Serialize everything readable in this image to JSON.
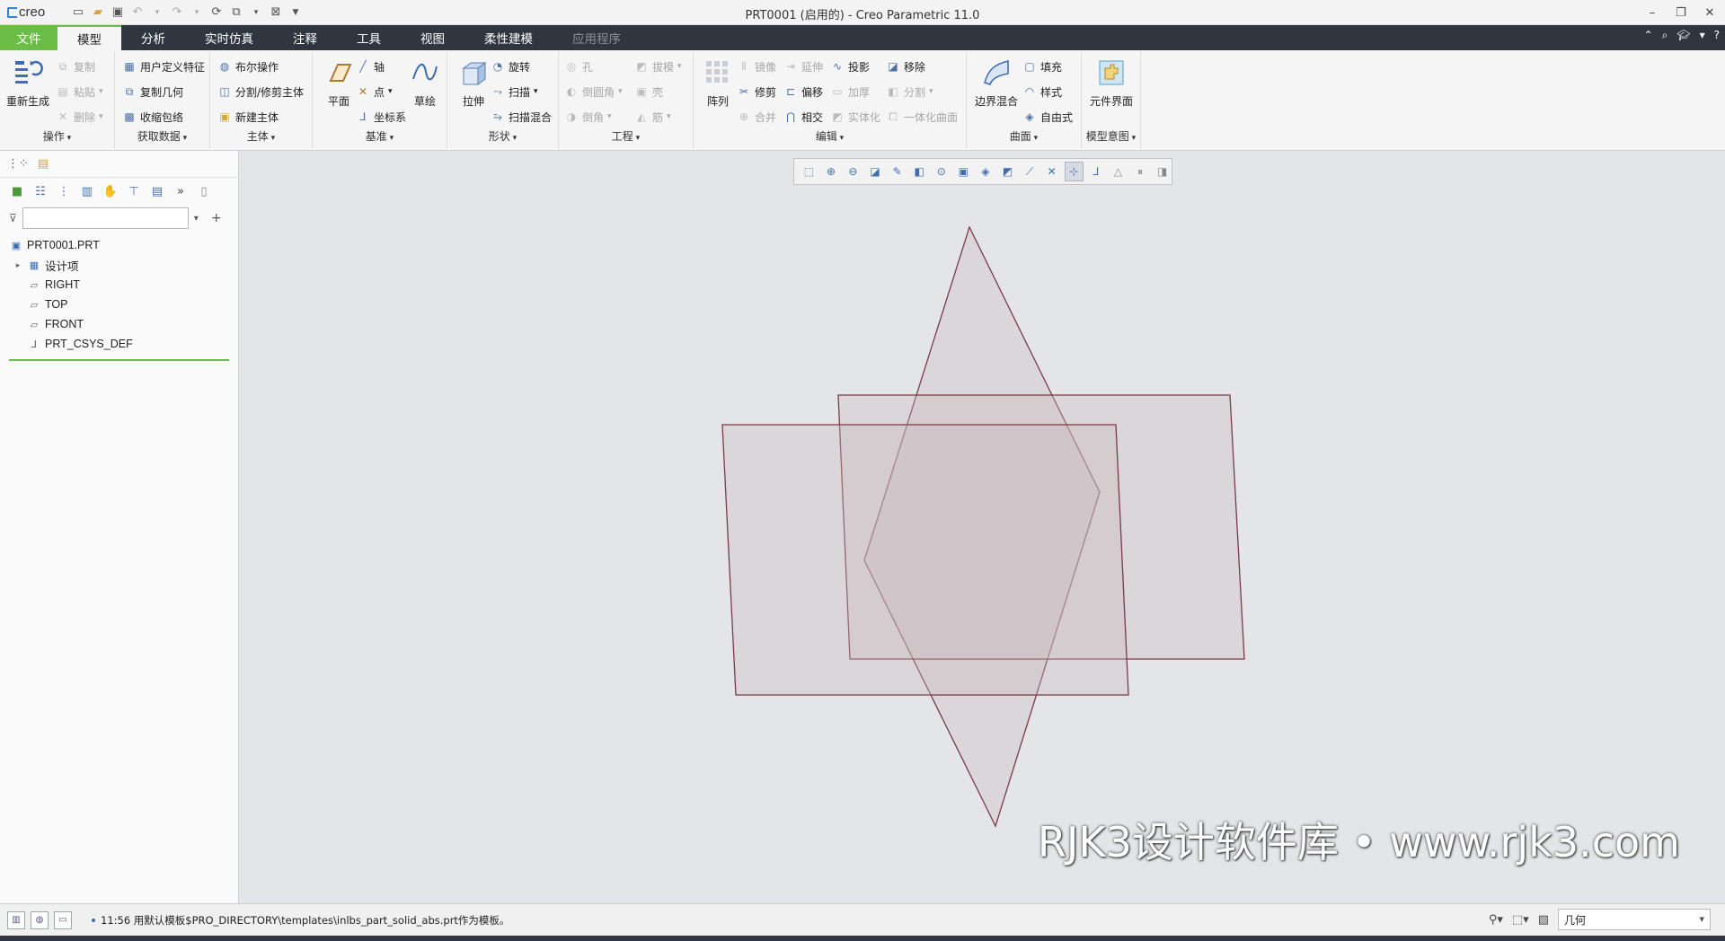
{
  "app": {
    "logo": "creo",
    "window_title": "PRT0001 (启用的) - Creo Parametric 11.0"
  },
  "tabs": [
    {
      "label": "文件"
    },
    {
      "label": "模型"
    },
    {
      "label": "分析"
    },
    {
      "label": "实时仿真"
    },
    {
      "label": "注释"
    },
    {
      "label": "工具"
    },
    {
      "label": "视图"
    },
    {
      "label": "柔性建模"
    },
    {
      "label": "应用程序"
    }
  ],
  "ribbon": {
    "ops": {
      "label": "操作",
      "regen": "重新生成",
      "copy": "复制",
      "paste": "粘贴",
      "delete": "删除"
    },
    "getdata": {
      "label": "获取数据",
      "udf": "用户定义特征",
      "copygeom": "复制几何",
      "shrinkwrap": "收缩包络"
    },
    "body": {
      "label": "主体",
      "boolean": "布尔操作",
      "split": "分割/修剪主体",
      "newbody": "新建主体"
    },
    "datum": {
      "label": "基准",
      "plane": "平面",
      "axis": "轴",
      "point": "点",
      "csys": "坐标系",
      "sketch": "草绘"
    },
    "shapes": {
      "label": "形状",
      "extrude": "拉伸",
      "revolve": "旋转",
      "sweep": "扫描",
      "sweptblend": "扫描混合"
    },
    "engineering": {
      "label": "工程",
      "hole": "孔",
      "round": "倒圆角",
      "chamfer": "倒角",
      "draft": "拔模",
      "shell": "壳",
      "rib": "筋"
    },
    "editing": {
      "label": "编辑",
      "pattern": "阵列",
      "mirror": "镜像",
      "extend": "延伸",
      "project": "投影",
      "remove": "移除",
      "trim": "修剪",
      "offset": "偏移",
      "thicken": "加厚",
      "split": "分割",
      "merge": "合并",
      "intersect": "相交",
      "solidify": "实体化",
      "unify": "一体化曲面"
    },
    "surfaces": {
      "label": "曲面",
      "boundary": "边界混合",
      "fill": "填充",
      "style": "样式",
      "freestyle": "自由式"
    },
    "intent": {
      "label": "模型意图",
      "component": "元件界面"
    }
  },
  "model_tree": {
    "filter_placeholder": "",
    "items": [
      {
        "label": "PRT0001.PRT"
      },
      {
        "label": "设计项"
      },
      {
        "label": "RIGHT"
      },
      {
        "label": "TOP"
      },
      {
        "label": "FRONT"
      },
      {
        "label": "PRT_CSYS_DEF"
      }
    ]
  },
  "watermark": "RJK3设计软件库 • www.rjk3.com",
  "status": {
    "message": "11:56 用默认模板$PRO_DIRECTORY\\templates\\inlbs_part_solid_abs.prt作为模板。",
    "filter_value": "几何"
  },
  "colors": {
    "accent_green": "#6abd45",
    "tabbar": "#2f3640",
    "plane_edge": "#7a3b45"
  }
}
